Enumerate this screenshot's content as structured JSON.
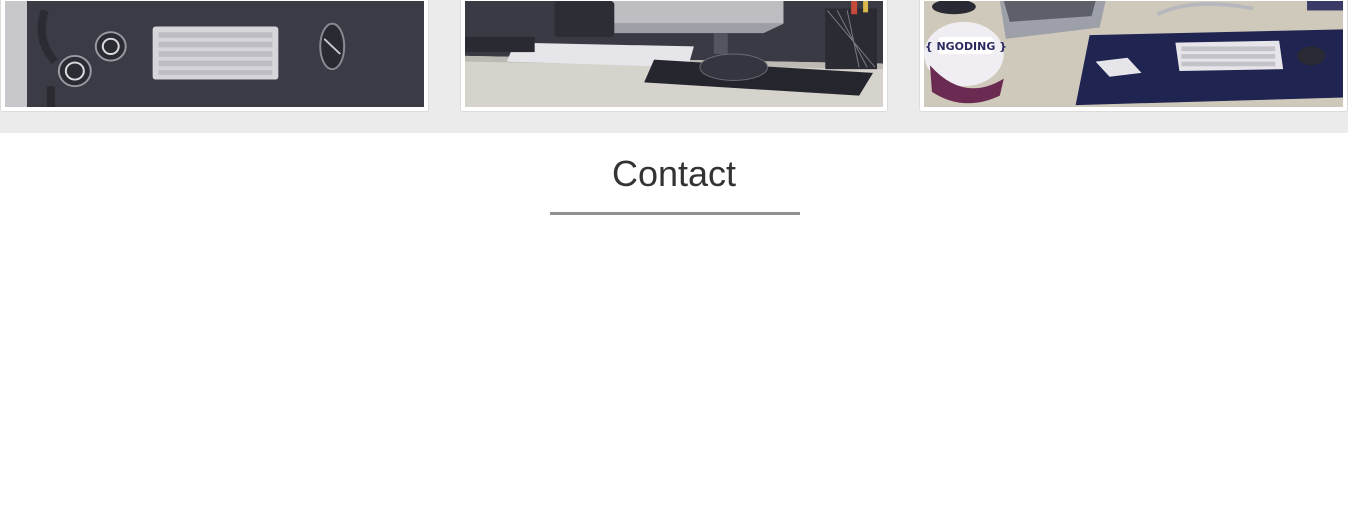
{
  "portfolio": {
    "images": [
      {
        "name": "desk-headphones-keyboard-photo"
      },
      {
        "name": "desk-monitor-keyboard-photo"
      },
      {
        "name": "desk-laptop-cap-photo"
      }
    ],
    "overlay_color": "#4a4a6a",
    "strip_background": "#ebebeb"
  },
  "contact": {
    "title": "Contact",
    "rule_color": "#8f8f8f"
  }
}
